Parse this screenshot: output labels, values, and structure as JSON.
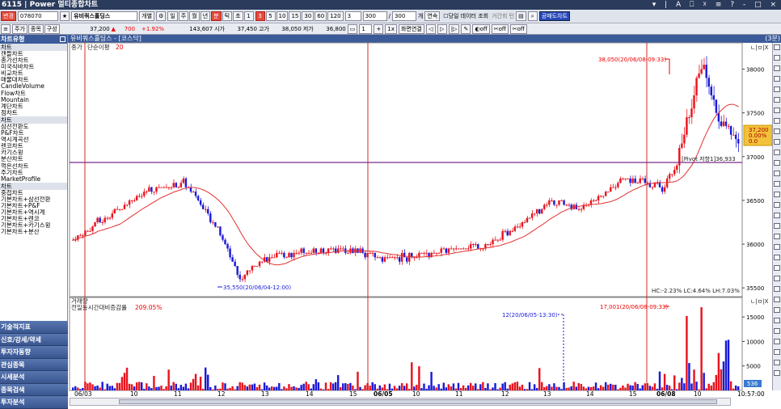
{
  "window": {
    "title": "6115 | Power 멀티종합차트",
    "controls": "▾ | A ⎕ ☓ ≡ ? ‐ □ ×"
  },
  "toolbar1": {
    "mode": "변경",
    "code": "078070",
    "star": "★",
    "name": "유비쿼스홀딩스",
    "indiv": "개별",
    "periods": [
      "일",
      "주",
      "월",
      "년",
      "분",
      "틱",
      "초",
      "1"
    ],
    "minutes": [
      "3",
      "5",
      "10",
      "15",
      "30",
      "60",
      "120"
    ],
    "count1": "3",
    "count2": "300",
    "slash": "/",
    "count3": "300",
    "unit": "개",
    "cont": "연속",
    "today": "당일 데이터 조회",
    "gap": "거간회 턴",
    "sell": "공매도차트"
  },
  "toolbar2": {
    "tabs": [
      "주가",
      "종목",
      "구성"
    ],
    "price": "37,200",
    "arrow": "▲",
    "change": "700",
    "pct": "+1.92%",
    "volume": "143,607",
    "open_label": "시가",
    "open": "37,450",
    "high_label": "고가",
    "high": "38,050",
    "low_label": "저가",
    "low": "36,800",
    "one": "1",
    "ix": "1x",
    "screen": "화면연결",
    "off1": "off",
    "off2": "off",
    "off3": "off"
  },
  "sidebar": {
    "title": "차트유형",
    "groups": [
      {
        "name": "차트",
        "items": [
          "캔들차트",
          "종가선차트",
          "미국식바차트",
          "비교차트",
          "매물대차트",
          "CandleVolume",
          "Flow차트",
          "Mountain",
          "계단차트",
          "점차트"
        ]
      },
      {
        "name": "차트",
        "items": [
          "삼선전환도",
          "P&F차트",
          "역시계곡선",
          "렌코차트",
          "카기스윙",
          "분산차트",
          "꺽은선차트",
          "주기차트",
          "MarketProfile"
        ]
      },
      {
        "name": "차트",
        "items": [
          "중첩차트",
          "기본차트+삼선전환",
          "기본차트+P&F",
          "기본차트+역시계",
          "기본차트+렌코",
          "기본차트+카기스윙",
          "기본차트+분산"
        ]
      }
    ],
    "bottom": [
      "기술적지표",
      "신호/강세/약세",
      "투자자동향",
      "관심종목",
      "시세분석",
      "종목검색",
      "투자분석"
    ]
  },
  "chart_header": {
    "title": "유비쿼스홀딩스 - [코스닥]",
    "right": "(3분)"
  },
  "price_panel": {
    "legend_price": "종가",
    "legend_ma": "단순이평",
    "ma_period": "20",
    "annotations": {
      "high": "38,050(20/06/08-09:33)",
      "low": "35,550(20/06/04-12:00)",
      "pivot": "[Pivot 저항1]36,933",
      "hcl": "HC:-2.23%  LC:4.64%  LH:7.03%"
    },
    "current_box": [
      "37,200",
      "0.00%",
      "0.0"
    ],
    "ctrl": "ㄴ|ㅁ|X"
  },
  "volume_panel": {
    "title": "거래량",
    "legend": "전일동시간대비증감률",
    "pct": "209.05%",
    "peak_label": "17,001(20/06/08-09:33)",
    "note_label": "12(20/06/05-13:30)",
    "cur_vol": "536",
    "ctrl": "ㄴ|ㅁ|X"
  },
  "time_axis": {
    "end_time": "10:57:00"
  },
  "colors": {
    "up": "#e8141e",
    "down": "#1a1ad8",
    "ma": "#e23030",
    "pivot": "#7a2a8a",
    "vline": "#d42a2a"
  },
  "chart_data": [
    {
      "type": "candlestick",
      "title": "유비쿼스홀딩스 - [코스닥]",
      "interval": "3분",
      "ylim": [
        35400,
        38300
      ],
      "yticks": [
        35500,
        36000,
        36500,
        37000,
        37500,
        38000
      ],
      "xticks": [
        "06/03",
        "10",
        "11",
        "12",
        "13",
        "14",
        "15",
        "06/05",
        "10",
        "11",
        "12",
        "13",
        "14",
        "15",
        "06/08",
        "10"
      ],
      "key_points": [
        {
          "x": "06/03 09:00",
          "close": 36050
        },
        {
          "x": "06/03 10:45",
          "close": 36700
        },
        {
          "x": "06/04 12:00",
          "low": 35550
        },
        {
          "x": "06/05 12:00",
          "close": 36700
        },
        {
          "x": "06/05 15:30",
          "close": 36650
        },
        {
          "x": "06/08 09:33",
          "high": 38050
        },
        {
          "x": "06/08 10:57",
          "close": 37200
        }
      ],
      "ma20": {
        "period": 20
      },
      "pivot_resistance1": 36933
    },
    {
      "type": "bar",
      "title": "거래량",
      "ylim": [
        0,
        18000
      ],
      "yticks": [
        5000,
        10000,
        15000
      ],
      "peak": 17001
    }
  ]
}
